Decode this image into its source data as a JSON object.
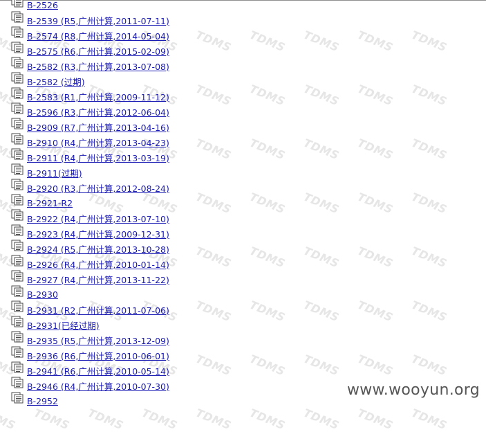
{
  "tree": {
    "items": [
      {
        "label": "B-2526"
      },
      {
        "label": "B-2539 (R5,广州计算,2011-07-11)"
      },
      {
        "label": "B-2574 (R8,广州计算,2014-05-04)"
      },
      {
        "label": "B-2575 (R6,广州计算,2015-02-09)"
      },
      {
        "label": "B-2582 (R3,广州计算,2013-07-08)"
      },
      {
        "label": "B-2582 (过期)"
      },
      {
        "label": "B-2583 (R1,广州计算,2009-11-12)"
      },
      {
        "label": "B-2596 (R3,广州计算,2012-06-04)"
      },
      {
        "label": "B-2909 (R7,广州计算,2013-04-16)"
      },
      {
        "label": "B-2910 (R4,广州计算,2013-04-23)"
      },
      {
        "label": "B-2911 (R4,广州计算,2013-03-19)"
      },
      {
        "label": "B-2911(过期)"
      },
      {
        "label": "B-2920 (R3,广州计算,2012-08-24)"
      },
      {
        "label": "B-2921-R2"
      },
      {
        "label": "B-2922 (R4,广州计算,2013-07-10)"
      },
      {
        "label": "B-2923 (R4,广州计算,2009-12-31)"
      },
      {
        "label": "B-2924 (R5,广州计算,2013-10-28)"
      },
      {
        "label": "B-2926 (R4,广州计算,2010-01-14)"
      },
      {
        "label": "B-2927 (R4,广州计算,2013-11-22)"
      },
      {
        "label": "B-2930"
      },
      {
        "label": "B-2931 (R2,广州计算,2011-07-06)"
      },
      {
        "label": "B-2931(已经过期)"
      },
      {
        "label": "B-2935 (R5,广州计算,2013-12-09)"
      },
      {
        "label": "B-2936 (R6,广州计算,2010-06-01)"
      },
      {
        "label": "B-2941 (R6,广州计算,2010-05-14)"
      },
      {
        "label": "B-2946 (R4,广州计算,2010-07-30)"
      },
      {
        "label": "B-2952"
      }
    ],
    "icon": "document-icon"
  },
  "watermark": {
    "text": "TDMS"
  },
  "footer": {
    "site": "www.wooyun.org"
  },
  "colors": {
    "link": "#1a1ab4",
    "watermark": "#e6e6e6",
    "footer": "#555555"
  }
}
